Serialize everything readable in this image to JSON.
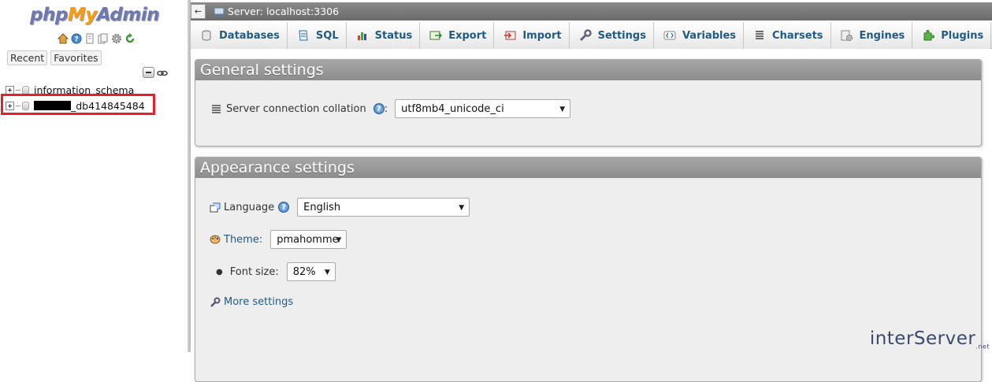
{
  "app": {
    "logo_prefix": "php",
    "logo_middle": "My",
    "logo_suffix": "Admin"
  },
  "nav": {
    "logo_icons": [
      "home-icon",
      "help-icon",
      "docs-icon",
      "copy-icon",
      "settings-icon",
      "reload-icon"
    ],
    "tabs": [
      {
        "label": "Recent"
      },
      {
        "label": "Favorites"
      }
    ],
    "databases": [
      {
        "name": "information_schema",
        "redacted_prefix": false
      },
      {
        "name": "_db414845484",
        "redacted_prefix": true
      }
    ]
  },
  "topbar": {
    "back_label": "←",
    "server_label": "Server: localhost:3306"
  },
  "menu": {
    "tabs": [
      {
        "label": "Databases",
        "icon": "database-icon"
      },
      {
        "label": "SQL",
        "icon": "sql-icon"
      },
      {
        "label": "Status",
        "icon": "status-icon"
      },
      {
        "label": "Export",
        "icon": "export-icon"
      },
      {
        "label": "Import",
        "icon": "import-icon"
      },
      {
        "label": "Settings",
        "icon": "wrench-icon"
      },
      {
        "label": "Variables",
        "icon": "variables-icon"
      },
      {
        "label": "Charsets",
        "icon": "charsets-icon"
      },
      {
        "label": "Engines",
        "icon": "engines-icon"
      },
      {
        "label": "Plugins",
        "icon": "plugins-icon"
      }
    ]
  },
  "general": {
    "title": "General settings",
    "collation_label": "Server connection collation",
    "collation_help": "?",
    "collation_colon": ":",
    "collation_value": "utf8mb4_unicode_ci"
  },
  "appearance": {
    "title": "Appearance settings",
    "language_label": "Language",
    "language_value": "English",
    "theme_label": "Theme:",
    "theme_value": "pmahomme",
    "fontsize_label": "Font size:",
    "fontsize_value": "82%",
    "more_settings_label": "More settings"
  },
  "footer": {
    "brand": "interServer",
    "suffix": ".net"
  },
  "colors": {
    "link": "#235a81",
    "highlight": "#e8202a",
    "panel_header": "#999999"
  }
}
